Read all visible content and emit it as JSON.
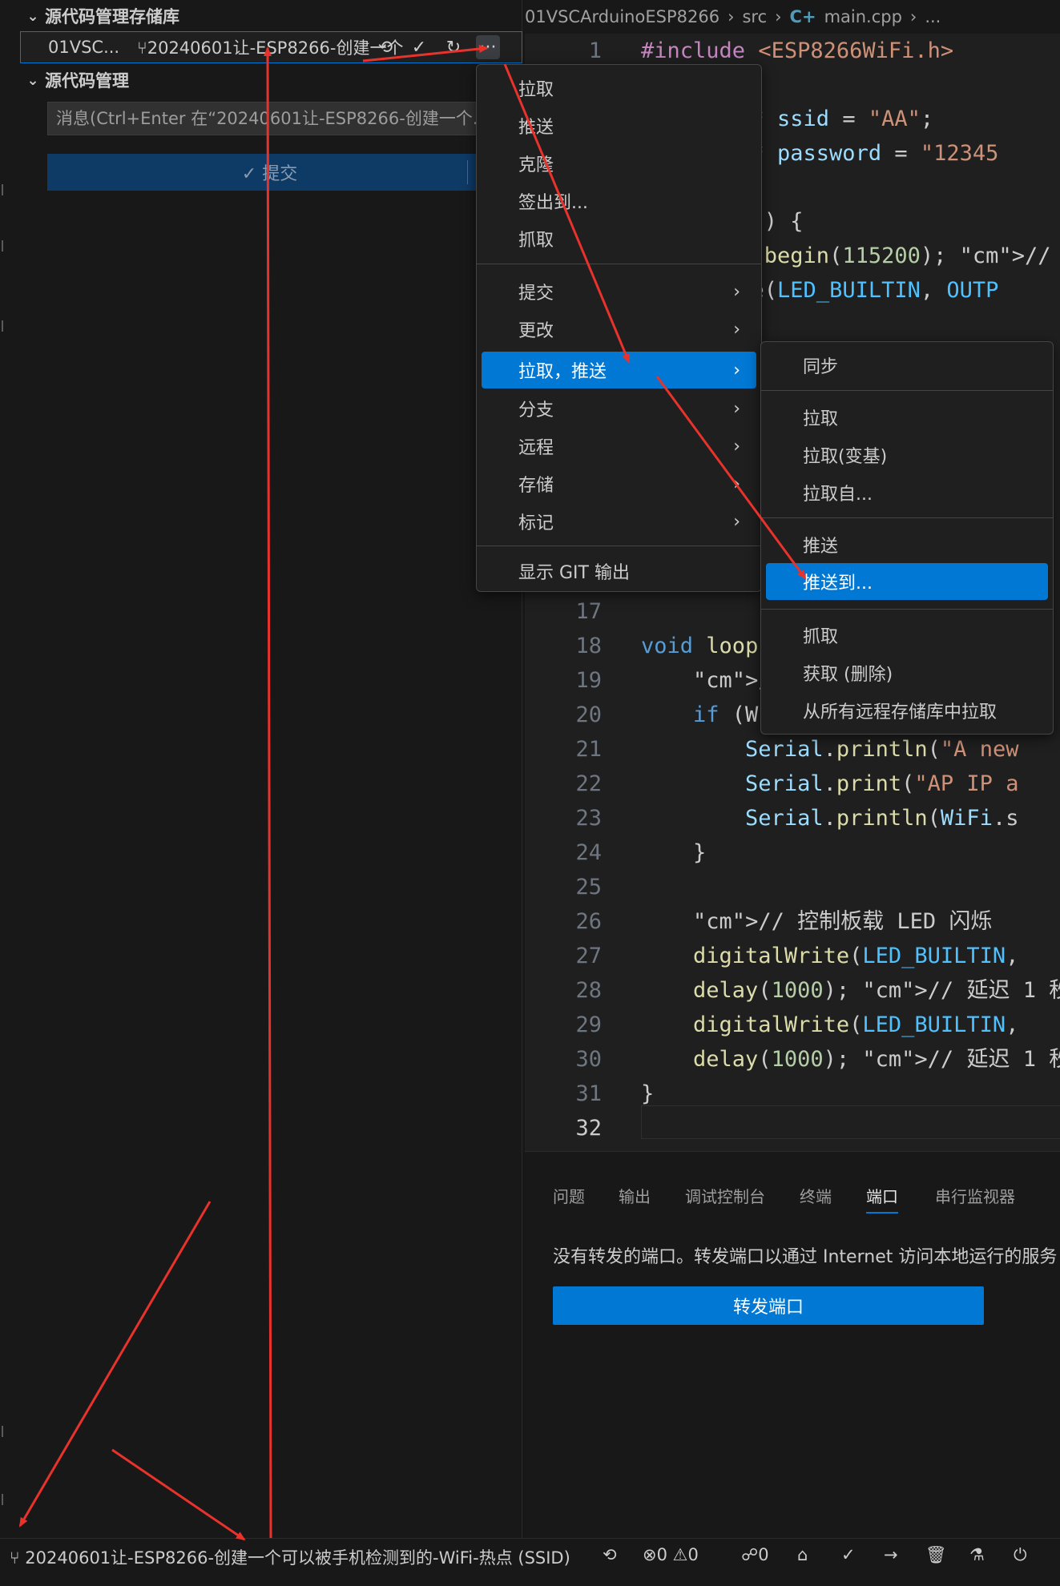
{
  "scm": {
    "repos_header": "源代码管理存储库",
    "repo_name": "01VSC...",
    "repo_branch": "20240601让-ESP8266-创建一个",
    "scm_header": "源代码管理",
    "commit_placeholder": "消息(Ctrl+Enter 在“20240601让-ESP8266-创建一个...",
    "commit_button": "✓ 提交",
    "more_glyph": "···"
  },
  "breadcrumb": [
    "01VSCArduinoESP8266",
    "src",
    "main.cpp",
    "..."
  ],
  "code": [
    {
      "n": "1",
      "text": "#include <ESP8266WiFi.h>"
    },
    {
      "n": "",
      "text": "ar* ssid = \"AA\";"
    },
    {
      "n": "",
      "text": "ar* password = \"12345"
    },
    {
      "n": "",
      "text": "up() {"
    },
    {
      "n": "",
      "text": "al.begin(115200); // "
    },
    {
      "n": "",
      "text": "ode(LED_BUILTIN, OUTP"
    },
    {
      "n": "17",
      "text": ""
    },
    {
      "n": "18",
      "text": "void loop"
    },
    {
      "n": "19",
      "text": "    // 检"
    },
    {
      "n": "20",
      "text": "    if (W"
    },
    {
      "n": "21",
      "text": "        Serial.println(\"A new"
    },
    {
      "n": "22",
      "text": "        Serial.print(\"AP IP a"
    },
    {
      "n": "23",
      "text": "        Serial.println(WiFi.s"
    },
    {
      "n": "24",
      "text": "    }"
    },
    {
      "n": "25",
      "text": ""
    },
    {
      "n": "26",
      "text": "    // 控制板载 LED 闪烁"
    },
    {
      "n": "27",
      "text": "    digitalWrite(LED_BUILTIN,"
    },
    {
      "n": "28",
      "text": "    delay(1000); // 延迟 1 秒"
    },
    {
      "n": "29",
      "text": "    digitalWrite(LED_BUILTIN,"
    },
    {
      "n": "30",
      "text": "    delay(1000); // 延迟 1 秒"
    },
    {
      "n": "31",
      "text": "}"
    },
    {
      "n": "32",
      "text": ""
    }
  ],
  "menu_main": {
    "group1": [
      "拉取",
      "推送",
      "克隆",
      "签出到...",
      "抓取"
    ],
    "group2": [
      "提交",
      "更改",
      "拉取，推送",
      "分支",
      "远程",
      "存储",
      "标记"
    ],
    "group3": [
      "显示 GIT 输出"
    ],
    "highlighted": "拉取，推送"
  },
  "menu_sub": {
    "group1": [
      "同步"
    ],
    "group2": [
      "拉取",
      "拉取(变基)",
      "拉取自..."
    ],
    "group3": [
      "推送",
      "推送到..."
    ],
    "group4": [
      "抓取",
      "获取 (删除)",
      "从所有远程存储库中拉取"
    ],
    "highlighted": "推送到..."
  },
  "panel": {
    "tabs": [
      "问题",
      "输出",
      "调试控制台",
      "终端",
      "端口",
      "串行监视器"
    ],
    "active_tab": "端口",
    "message": "没有转发的端口。转发端口以通过 Internet 访问本地运行的服务",
    "forward_button": "转发端口"
  },
  "statusbar": {
    "branch": "20240601让-ESP8266-创建一个可以被手机检测到的-WiFi-热点 (SSID)",
    "errors": "0",
    "warnings": "0",
    "ports": "0"
  },
  "colors": {
    "accent": "#0078d4",
    "annotation": "#e8322c"
  }
}
